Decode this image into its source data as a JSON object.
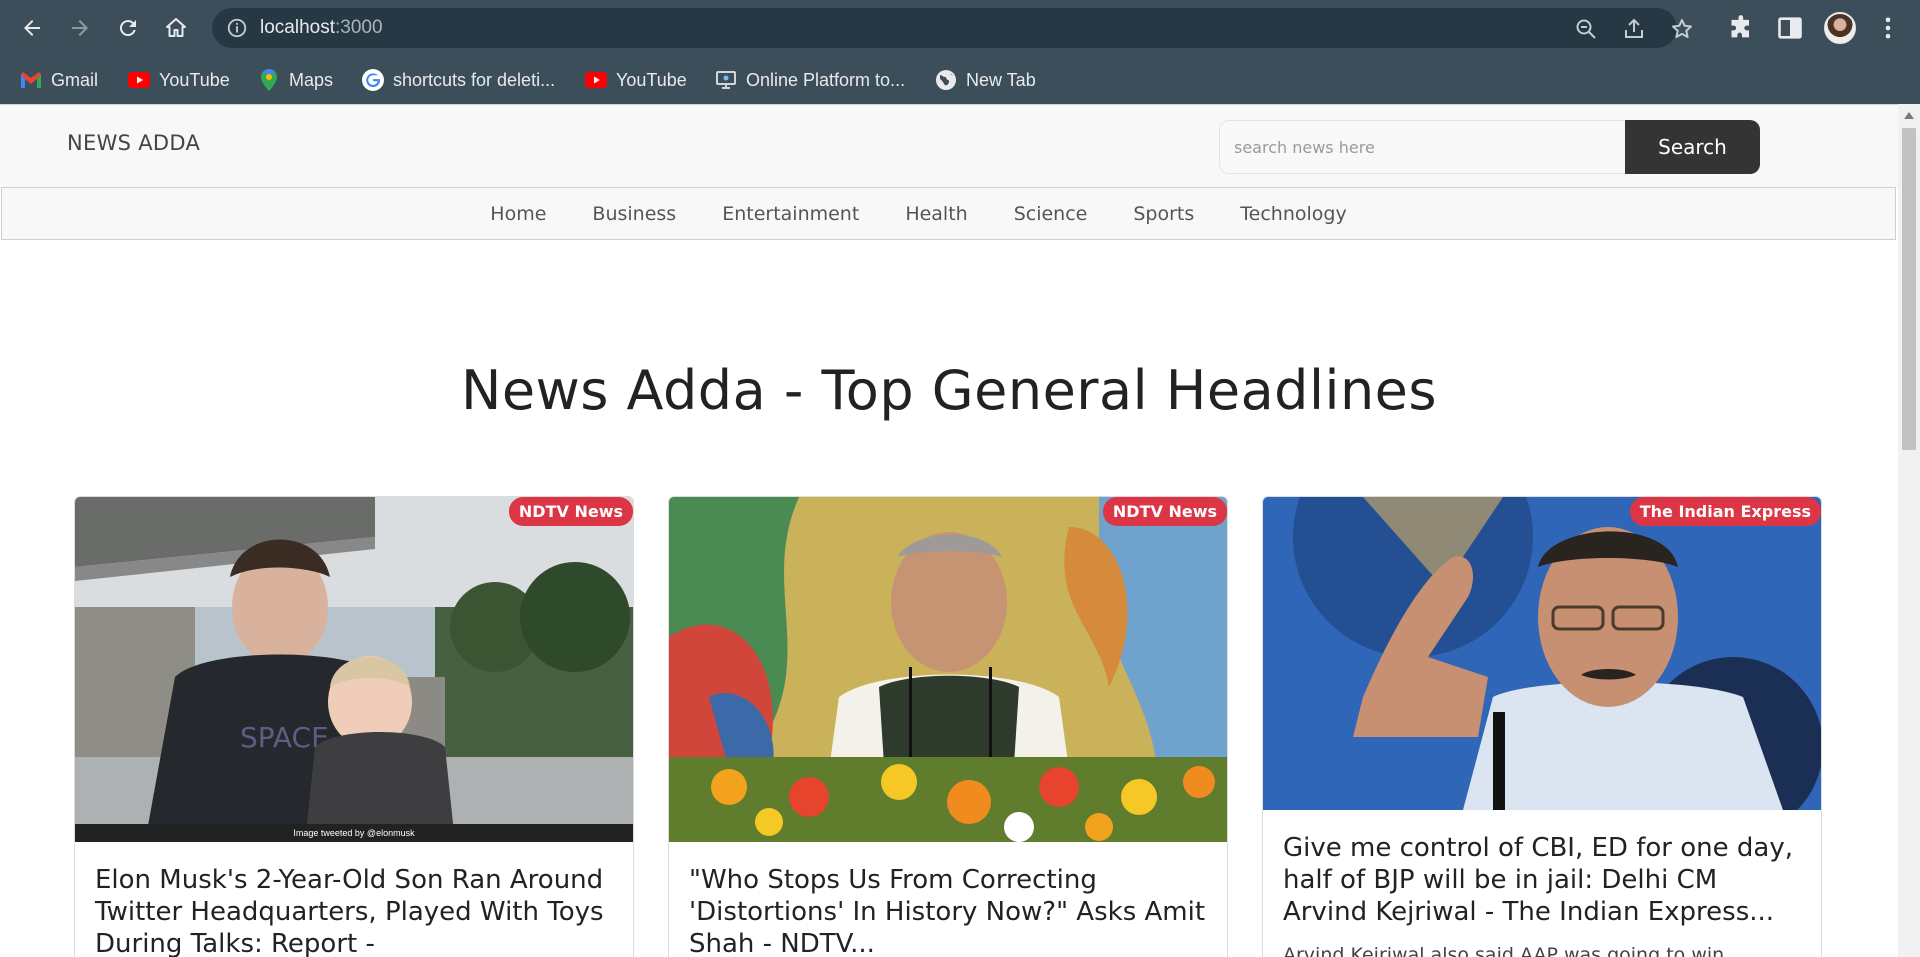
{
  "browser": {
    "url_host": "localhost",
    "url_port": ":3000",
    "bookmarks": [
      {
        "label": "Gmail",
        "icon": "gmail-icon"
      },
      {
        "label": "YouTube",
        "icon": "youtube-icon"
      },
      {
        "label": "Maps",
        "icon": "maps-icon"
      },
      {
        "label": "shortcuts for deleti...",
        "icon": "google-icon"
      },
      {
        "label": "YouTube",
        "icon": "youtube-icon"
      },
      {
        "label": "Online Platform to...",
        "icon": "platform-icon"
      },
      {
        "label": "New Tab",
        "icon": "globe-icon"
      }
    ]
  },
  "site": {
    "brand": "NEWS ADDA",
    "search_placeholder": "search news here",
    "search_button": "Search",
    "nav": [
      "Home",
      "Business",
      "Entertainment",
      "Health",
      "Science",
      "Sports",
      "Technology"
    ],
    "heading": "News Adda - Top General Headlines"
  },
  "articles": [
    {
      "source": "NDTV News",
      "title": "Elon Musk's 2-Year-Old Son Ran Around Twitter Headquarters, Played With Toys During Talks: Report -",
      "caption": "Image tweeted by @elonmusk"
    },
    {
      "source": "NDTV News",
      "title": "\"Who Stops Us From Correcting 'Distortions' In History Now?\" Asks Amit Shah - NDTV..."
    },
    {
      "source": "The Indian Express",
      "title": "Give me control of CBI, ED for one day, half of BJP will be in jail: Delhi CM Arvind Kejriwal - The Indian Express...",
      "description": "Arvind Kejriwal also said AAP was going to win"
    }
  ],
  "colors": {
    "chrome_bg": "#3c4e5a",
    "omnibox_bg": "#263843",
    "badge_red": "#dc3545",
    "search_button_bg": "#343434",
    "header_bg": "#f8f8f8"
  }
}
